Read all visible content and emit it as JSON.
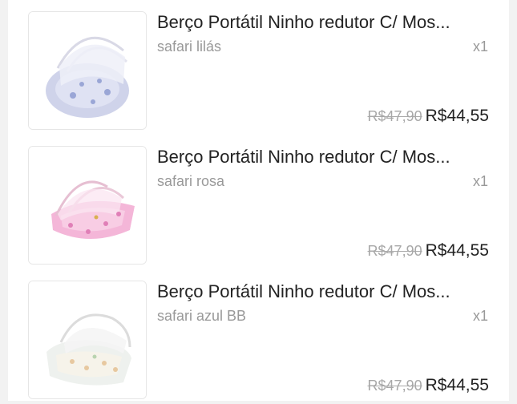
{
  "cart": {
    "items": [
      {
        "title": "Berço Portátil Ninho redutor C/ Mos...",
        "variant": "safari lilás",
        "quantity": "x1",
        "original_price": "R$47,90",
        "price": "R$44,55",
        "image_icon": "baby-nest-lilac-image",
        "colors": {
          "fabric": "#cfd3ea",
          "pattern": "#9aa6d6"
        }
      },
      {
        "title": "Berço Portátil Ninho redutor C/ Mos...",
        "variant": "safari rosa",
        "quantity": "x1",
        "original_price": "R$47,90",
        "price": "R$44,55",
        "image_icon": "baby-nest-pink-image",
        "colors": {
          "fabric": "#f4b6d8",
          "pattern": "#e07fb7"
        }
      },
      {
        "title": "Berço Portátil Ninho redutor C/ Mos...",
        "variant": "safari azul BB",
        "quantity": "x1",
        "original_price": "R$47,90",
        "price": "R$44,55",
        "image_icon": "baby-nest-blue-image",
        "colors": {
          "fabric": "#eef1ee",
          "pattern": "#e7c8a0"
        }
      }
    ]
  }
}
